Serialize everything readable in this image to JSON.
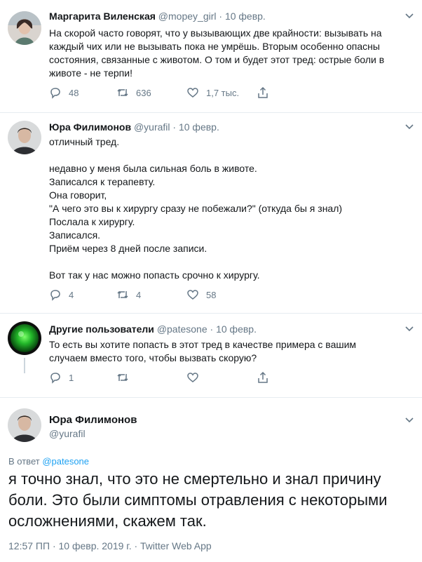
{
  "tweets": [
    {
      "name": "Маргарита Виленская",
      "handle": "@mopey_girl",
      "sep": "·",
      "date": "10 февр.",
      "lines": [
        "На скорой часто говорят, что у вызывающих две крайности: вызывать на",
        "каждый чих или не вызывать пока не умрёшь. Вторым особенно опасны",
        "состояния, связанные с животом. О том и будет этот тред: острые боли в",
        "животе - не терпи!"
      ],
      "replies": "48",
      "retweets": "636",
      "likes": "1,7 тыс."
    },
    {
      "name": "Юра Филимонов",
      "handle": "@yurafil",
      "sep": "·",
      "date": "10 февр.",
      "lines": [
        "отличный тред.",
        "",
        "недавно у меня была сильная боль в животе.",
        "Записался к терапевту.",
        "Она говорит,",
        "\"А чего это вы к хирургу сразу не побежали?\" (откуда бы я знал)",
        "Послала к хирургу.",
        "Записался.",
        "Приём через 8 дней после записи.",
        "",
        "Вот так у нас можно попасть срочно к хирургу."
      ],
      "replies": "4",
      "retweets": "4",
      "likes": "58"
    },
    {
      "name": "Другие пользователи",
      "handle": "@patesone",
      "sep": "·",
      "date": "10 февр.",
      "lines": [
        "То есть вы хотите попасть в этот тред в качестве примера с вашим",
        "случаем вместо того, чтобы вызвать скорую?"
      ],
      "replies": "1",
      "retweets": "",
      "likes": ""
    }
  ],
  "main": {
    "name": "Юра Филимонов",
    "handle": "@yurafil",
    "reply_prefix": "В ответ",
    "reply_mention": "@patesone",
    "lines": [
      "я точно знал, что это не смертельно и знал причину",
      "боли. Это были симптомы отравления с некоторыми",
      "осложнениями, скажем так."
    ],
    "meta": "12:57 ПП · 10 февр. 2019 г. · Twitter Web App"
  },
  "icons": {
    "reply": "reply-icon",
    "retweet": "retweet-icon",
    "like": "heart-icon",
    "share": "share-icon",
    "caret": "chevron-down-icon"
  },
  "colors": {
    "text": "#14171a",
    "muted": "#657786",
    "link": "#1da1f2",
    "border": "#e6ecf0"
  }
}
